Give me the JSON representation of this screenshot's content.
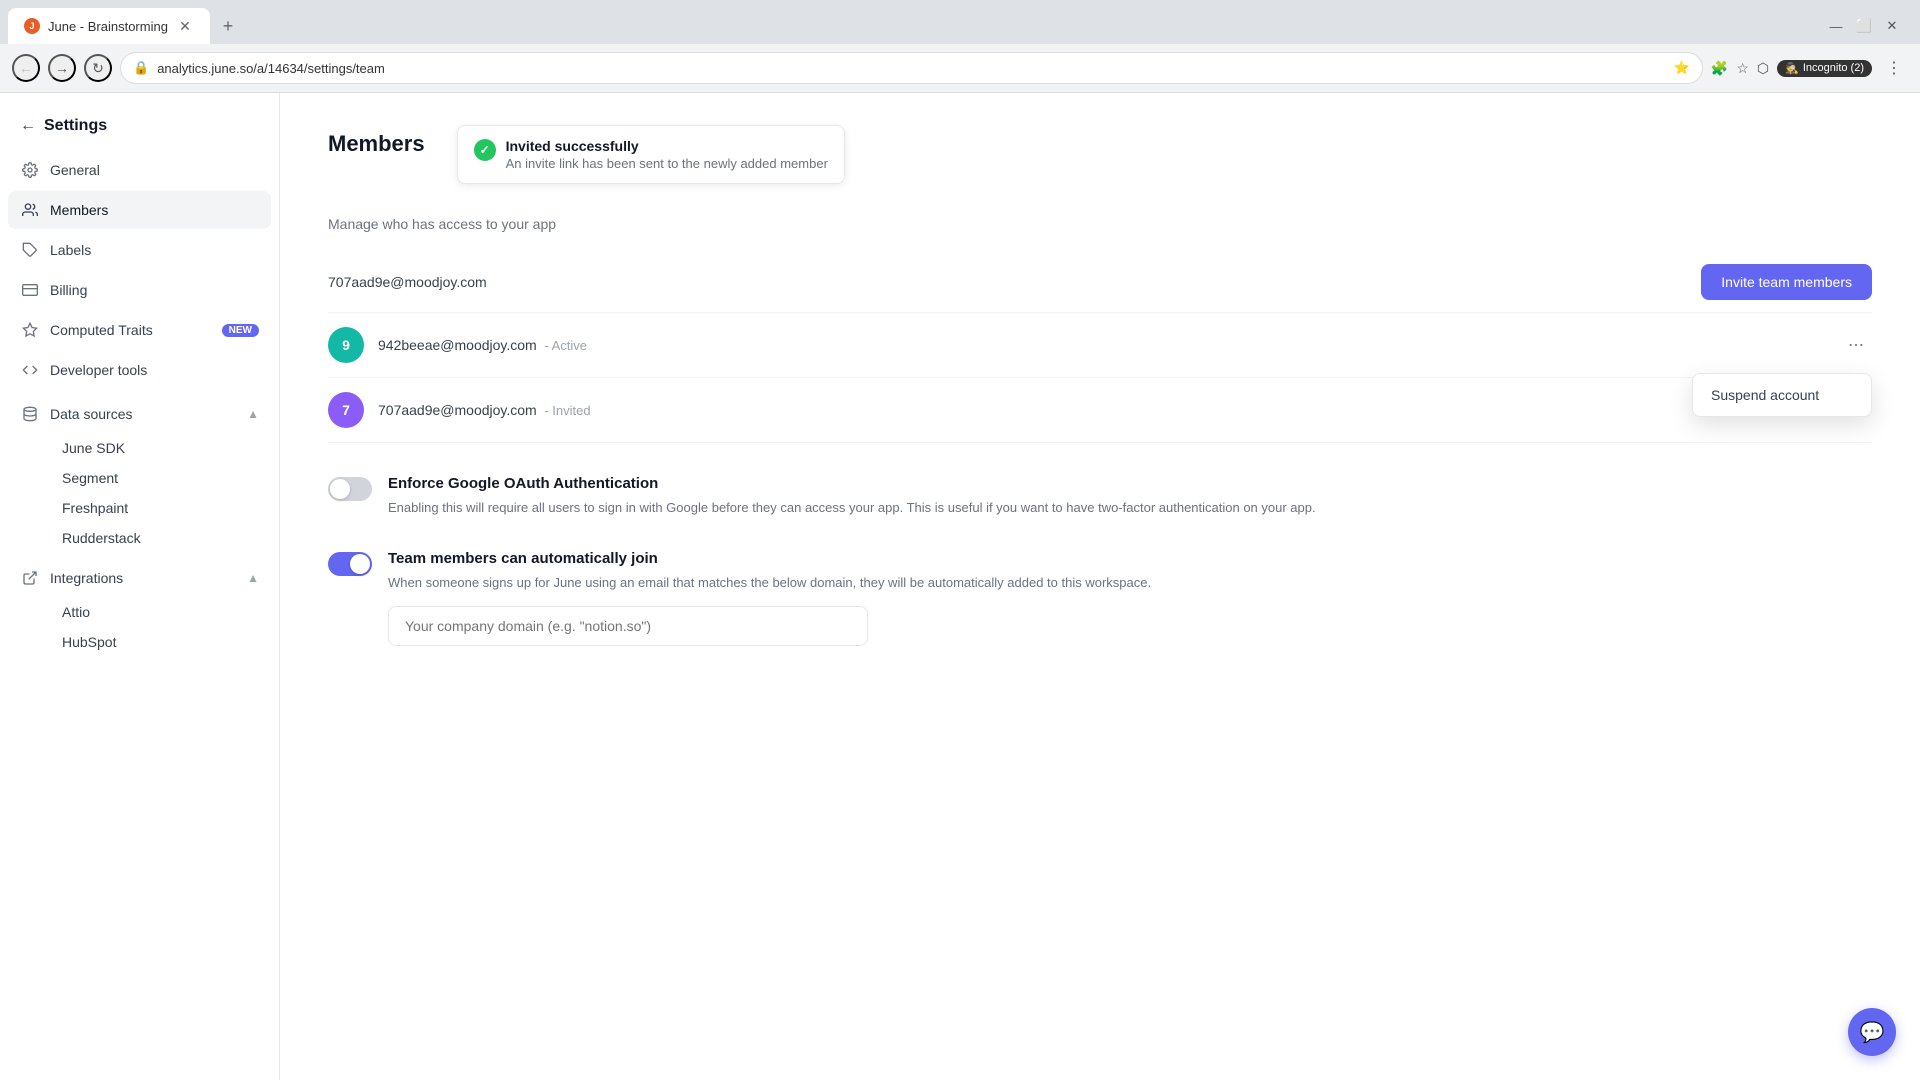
{
  "browser": {
    "tab_title": "June - Brainstorming",
    "tab_favicon": "J",
    "url": "analytics.june.so/a/14634/settings/team",
    "new_tab_icon": "+",
    "incognito_label": "Incognito (2)"
  },
  "sidebar": {
    "back_label": "Settings",
    "items": [
      {
        "id": "general",
        "label": "General",
        "icon": "gear"
      },
      {
        "id": "members",
        "label": "Members",
        "icon": "users",
        "active": true
      },
      {
        "id": "labels",
        "label": "Labels",
        "icon": "tag"
      },
      {
        "id": "billing",
        "label": "Billing",
        "icon": "credit-card"
      },
      {
        "id": "computed-traits",
        "label": "Computed Traits",
        "icon": "sparkle",
        "badge": "New"
      },
      {
        "id": "developer-tools",
        "label": "Developer tools",
        "icon": "code"
      }
    ],
    "groups": [
      {
        "id": "data-sources",
        "label": "Data sources",
        "icon": "database",
        "expanded": true,
        "sub_items": [
          "June SDK",
          "Segment",
          "Freshpaint",
          "Rudderstack"
        ]
      },
      {
        "id": "integrations",
        "label": "Integrations",
        "icon": "plug",
        "expanded": true,
        "sub_items": [
          "Attio",
          "HubSpot"
        ]
      }
    ]
  },
  "page": {
    "title": "Members",
    "subtitle": "Manage who has access to your app"
  },
  "toast": {
    "title": "Invited successfully",
    "subtitle": "An invite link has been sent to the newly added member"
  },
  "members": {
    "invite_btn_label": "Invite team members",
    "current_user_email": "707aad9e@moodjoy.com",
    "list": [
      {
        "email": "942beeae@moodjoy.com",
        "status": "Active",
        "avatar_text": "9",
        "avatar_color": "teal"
      },
      {
        "email": "707aad9e@moodjoy.com",
        "status": "Invited",
        "avatar_text": "7",
        "avatar_color": "purple"
      }
    ]
  },
  "dropdown": {
    "items": [
      {
        "label": "Suspend account"
      }
    ]
  },
  "oauth_section": {
    "title": "Enforce Google OAuth Authentication",
    "description": "Enabling this will require all users to sign in with Google before they can access your app. This is useful if you want to have two-factor authentication on your app.",
    "enabled": false
  },
  "auto_join_section": {
    "title": "Team members can automatically join",
    "description": "When someone signs up for June using an email that matches the below domain, they will be automatically added to this workspace.",
    "enabled": true,
    "domain_placeholder": "Your company domain (e.g. \"notion.so\")"
  },
  "chat_fab": {
    "icon": "💬"
  }
}
